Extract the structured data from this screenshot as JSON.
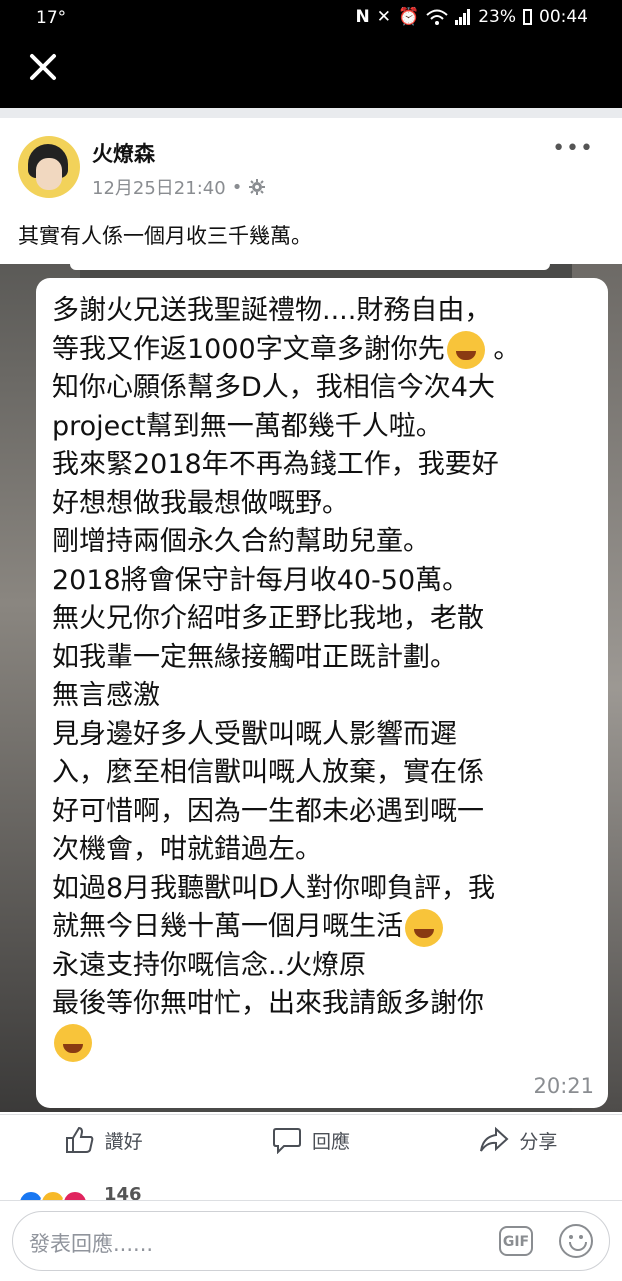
{
  "status_bar": {
    "temperature": "17°",
    "battery": "23%",
    "time": "00:44"
  },
  "post": {
    "author": "火燎森",
    "date": "12月25日21:40",
    "separator": "•",
    "text": "其實有人係一個月收三千幾萬。",
    "image_message": {
      "lines": [
        "多謝火兄送我聖誕禮物....財務自由，",
        "等我又作返1000字文章多謝你先",
        "知你心願係幫多D人，我相信今次4大",
        "project幫到無一萬都幾千人啦。",
        "我來緊2018年不再為錢工作，我要好",
        "好想想做我最想做嘅野。",
        "剛增持兩個永久合約幫助兒童。",
        "2018將會保守計每月收40-50萬。",
        "無火兄你介紹咁多正野比我地，老散",
        "如我輩一定無緣接觸咁正既計劃。",
        "無言感激",
        "見身邊好多人受獸叫嘅人影響而遲",
        "入，麼至相信獸叫嘅人放棄，實在係",
        "好可惜啊，因為一生都未必遇到嘅一",
        "次機會，咁就錯過左。",
        "如過8月我聽獸叫D人對你唧負評，我",
        "就無今日幾十萬一個月嘅生活",
        "永遠支持你嘅信念..火燎原",
        "最後等你無咁忙，出來我請飯多謝你"
      ],
      "line2_suffix": "。",
      "time": "20:21"
    },
    "actions": {
      "like": "讚好",
      "comment": "回應",
      "share": "分享"
    },
    "reaction_count": "146"
  },
  "composer": {
    "placeholder": "發表回應......",
    "gif_label": "GIF"
  },
  "icons": [
    "close-icon",
    "nfc-icon",
    "mute-icon",
    "alarm-icon",
    "wifi-icon",
    "signal-icon",
    "battery-icon",
    "more-icon",
    "settings-icon",
    "like-icon",
    "comment-icon",
    "share-icon",
    "emoji-icon"
  ],
  "colors": {
    "accent": "#4b4f56",
    "meta": "#8a8d91",
    "reaction_like": "#1877f2",
    "reaction_haha": "#f7b928",
    "reaction_love": "#e0245e"
  }
}
